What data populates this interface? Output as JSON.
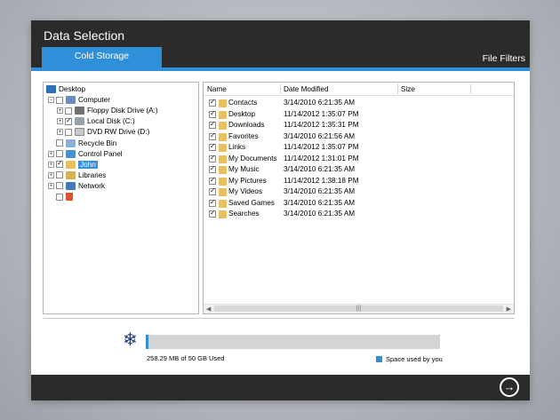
{
  "window": {
    "title": "Data Selection"
  },
  "tabs": {
    "active": "Cold Storage",
    "right": "File Filters"
  },
  "tree": {
    "items": [
      {
        "label": "Desktop",
        "icon": "desktop-icon",
        "checked": false,
        "expander": "",
        "level": 0
      },
      {
        "label": "Computer",
        "icon": "computer-icon",
        "checked": false,
        "expander": "-",
        "level": 1
      },
      {
        "label": "Floppy Disk Drive (A:)",
        "icon": "floppy-icon",
        "checked": false,
        "expander": "+",
        "level": 2
      },
      {
        "label": "Local Disk (C:)",
        "icon": "disk-icon",
        "checked": true,
        "expander": "+",
        "level": 2
      },
      {
        "label": "DVD RW Drive (D:)",
        "icon": "dvd-icon",
        "checked": false,
        "expander": "+",
        "level": 2
      },
      {
        "label": "Recycle Bin",
        "icon": "recycle-bin-icon",
        "checked": false,
        "expander": "",
        "level": 1
      },
      {
        "label": "Control Panel",
        "icon": "control-panel-icon",
        "checked": false,
        "expander": "+",
        "level": 1
      },
      {
        "label": "John",
        "icon": "user-folder-icon",
        "checked": true,
        "expander": "+",
        "level": 1,
        "selected": true
      },
      {
        "label": "Libraries",
        "icon": "libraries-icon",
        "checked": false,
        "expander": "+",
        "level": 1
      },
      {
        "label": "Network",
        "icon": "network-icon",
        "checked": false,
        "expander": "+",
        "level": 1
      },
      {
        "label": "",
        "icon": "homegroup-icon",
        "checked": false,
        "expander": "",
        "level": 1
      }
    ]
  },
  "files": {
    "columns": [
      "Name",
      "Date Modified",
      "Size"
    ],
    "rows": [
      {
        "name": "Contacts",
        "date": "3/14/2010 6:21:35 AM",
        "checked": true
      },
      {
        "name": "Desktop",
        "date": "11/14/2012 1:35:07 PM",
        "checked": true
      },
      {
        "name": "Downloads",
        "date": "11/14/2012 1:35:31 PM",
        "checked": true
      },
      {
        "name": "Favorites",
        "date": "3/14/2010 6:21:56 AM",
        "checked": true
      },
      {
        "name": "Links",
        "date": "11/14/2012 1:35:07 PM",
        "checked": true
      },
      {
        "name": "My Documents",
        "date": "11/14/2012 1:31:01 PM",
        "checked": true
      },
      {
        "name": "My Music",
        "date": "3/14/2010 6:21:35 AM",
        "checked": true
      },
      {
        "name": "My Pictures",
        "date": "11/14/2012 1:38:18 PM",
        "checked": true
      },
      {
        "name": "My Videos",
        "date": "3/14/2010 6:21:35 AM",
        "checked": true
      },
      {
        "name": "Saved Games",
        "date": "3/14/2010 6:21:35 AM",
        "checked": true
      },
      {
        "name": "Searches",
        "date": "3/14/2010 6:21:35 AM",
        "checked": true
      }
    ]
  },
  "usage": {
    "text": "258.29 MB of 50 GB Used",
    "fraction": 0.005,
    "legend": "Space used by you"
  },
  "colors": {
    "accent": "#2f8fd8",
    "chrome": "#2b2b2b"
  }
}
